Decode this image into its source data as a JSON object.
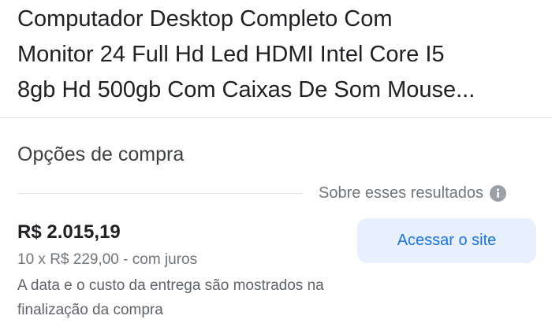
{
  "product": {
    "title_lines": [
      "Computador Desktop Completo Com",
      "Monitor 24 Full Hd Led HDMI Intel Core I5",
      "8gb Hd 500gb Com Caixas De Som Mouse..."
    ]
  },
  "purchase_options": {
    "heading": "Opções de compra",
    "about_results_label": "Sobre esses resultados",
    "about_results_icon": "info-icon",
    "offer": {
      "price": "R$ 2.015,19",
      "installments": "10 x R$ 229,00 - com juros",
      "delivery_note": "A data e o custo da entrega são mostrados na finalização da compra",
      "visit_button_label": "Acessar o site"
    }
  },
  "colors": {
    "button_background": "#e8f0fe",
    "button_text": "#1a73e8",
    "primary_text": "#202124",
    "secondary_text": "#70757a"
  }
}
